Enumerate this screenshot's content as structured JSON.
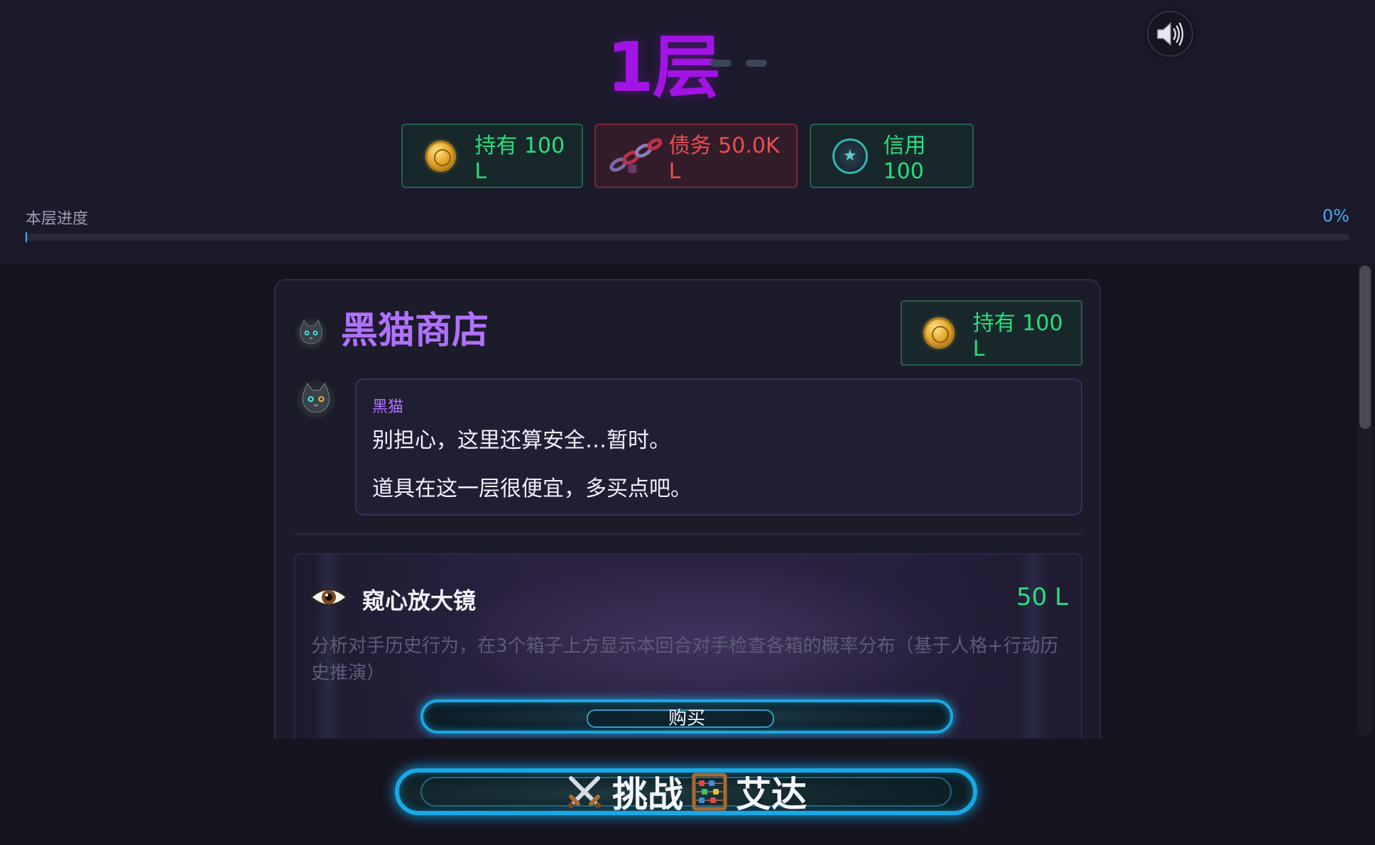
{
  "header": {
    "floor_title": "1层",
    "sound_icon": "speaker-icon"
  },
  "stats": {
    "held_label": "持有 100 L",
    "debt_label": "债务 50.0K L",
    "credit_label": "信用 100",
    "held_color": "#25e080",
    "debt_color": "#f04d4d"
  },
  "progress": {
    "label": "本层进度",
    "percent_text": "0%",
    "value": 0
  },
  "shop": {
    "title": "黑猫商店",
    "balance_label": "持有 100 L",
    "dialog": {
      "speaker": "黑猫",
      "line1": "别担心，这里还算安全…暂时。",
      "line2": "道具在这一层很便宜，多买点吧。"
    },
    "items": [
      {
        "icon": "eye-icon",
        "name": "窥心放大镜",
        "price": "50 L",
        "description": "分析对手历史行为，在3个箱子上方显示本回合对手检查各箱的概率分布（基于人格+行动历史推演）",
        "buy_label": "购买"
      }
    ]
  },
  "challenge": {
    "label_prefix": "挑战",
    "label_suffix": "艾达",
    "icon_left": "crossed-swords-icon",
    "icon_right": "abacus-icon"
  },
  "colors": {
    "accent_purple": "#a213e6",
    "shop_purple": "#b071ff",
    "button_glow": "#18a8e6"
  }
}
